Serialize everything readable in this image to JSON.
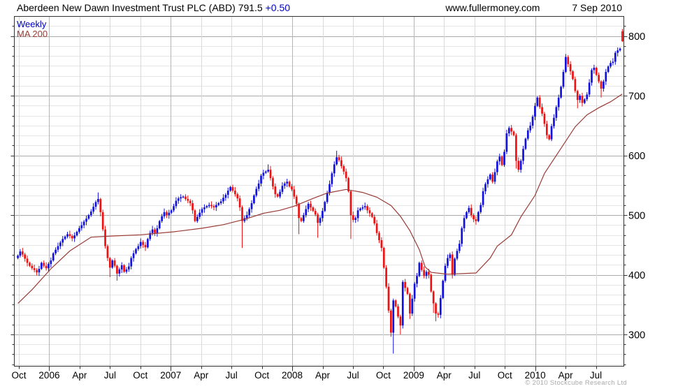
{
  "header": {
    "title": "Aberdeen New Dawn Investment Trust PLC (ABD)",
    "price": "791.5",
    "change": "+0.50",
    "site": "www.fullermoney.com",
    "date": "7 Sep 2010"
  },
  "legend": {
    "timeframe": "Weekly",
    "ma": "MA 200"
  },
  "footer": {
    "copyright": "© 2010 Stockcube Research Ltd"
  },
  "chart_data": {
    "type": "candlestick",
    "timeframe": "weekly",
    "title": "Aberdeen New Dawn Investment Trust PLC (ABD)",
    "last": 791.5,
    "change": 0.5,
    "legend_position": "top-left",
    "grid": true,
    "colors": {
      "up": "#1111dd",
      "down": "#ee1111",
      "ma": "#993b35",
      "grid_minor": "#e6e6e6",
      "grid_major": "#ababab",
      "grid_quarter": "#d9d9d9",
      "grid_year": "#b5b5b5",
      "border": "#333333",
      "tick": "#333333",
      "label": "#000000"
    },
    "y_axis": {
      "ticks": [
        300,
        400,
        500,
        600,
        700,
        800
      ],
      "minor_step": 16.667,
      "approx_range": [
        246,
        834
      ]
    },
    "x_axis": {
      "labels": [
        "Oct",
        "2006",
        "Apr",
        "Jul",
        "Oct",
        "2007",
        "Apr",
        "Jul",
        "Oct",
        "2008",
        "Apr",
        "Jul",
        "Oct",
        "2009",
        "Apr",
        "Jul",
        "Oct",
        "2010",
        "Apr",
        "Jul"
      ],
      "year_indices": [
        1,
        5,
        9,
        13,
        17
      ],
      "weeks_per_quarter": 13
    },
    "first_open": 428,
    "closes": [
      432,
      439,
      434,
      427,
      420,
      415,
      411,
      408,
      404,
      410,
      420,
      415,
      411,
      418,
      424,
      436,
      442,
      448,
      454,
      460,
      464,
      468,
      465,
      461,
      466,
      472,
      478,
      483,
      489,
      494,
      500,
      506,
      514,
      522,
      527,
      505,
      476,
      448,
      428,
      412,
      424,
      415,
      402,
      409,
      416,
      405,
      409,
      414,
      428,
      436,
      443,
      448,
      455,
      450,
      446,
      460,
      470,
      476,
      470,
      478,
      490,
      498,
      505,
      500,
      504,
      508,
      515,
      524,
      528,
      530,
      531,
      527,
      524,
      520,
      508,
      490,
      497,
      504,
      510,
      513,
      515,
      517,
      515,
      513,
      517,
      520,
      523,
      529,
      534,
      541,
      547,
      541,
      535,
      528,
      513,
      490,
      495,
      500,
      510,
      520,
      533,
      544,
      553,
      566,
      571,
      573,
      576,
      562,
      548,
      535,
      531,
      539,
      549,
      553,
      556,
      548,
      543,
      531,
      519,
      495,
      490,
      500,
      510,
      519,
      513,
      507,
      501,
      487,
      495,
      507,
      522,
      537,
      552,
      570,
      585,
      597,
      592,
      582,
      573,
      562,
      540,
      500,
      492,
      495,
      508,
      511,
      513,
      515,
      508,
      503,
      497,
      486,
      470,
      458,
      445,
      412,
      380,
      340,
      303,
      357,
      347,
      330,
      315,
      388,
      378,
      368,
      335,
      360,
      385,
      398,
      420,
      408,
      398,
      405,
      400,
      372,
      352,
      335,
      333,
      361,
      390,
      415,
      428,
      434,
      400,
      427,
      440,
      452,
      478,
      495,
      505,
      512,
      500,
      493,
      490,
      505,
      517,
      540,
      552,
      560,
      568,
      556,
      572,
      590,
      598,
      584,
      606,
      637,
      646,
      640,
      634,
      591,
      576,
      591,
      611,
      628,
      642,
      650,
      665,
      683,
      697,
      681,
      670,
      653,
      634,
      627,
      649,
      663,
      681,
      697,
      715,
      740,
      765,
      753,
      741,
      728,
      708,
      693,
      700,
      688,
      694,
      702,
      722,
      743,
      747,
      735,
      724,
      712,
      724,
      740,
      749,
      755,
      757,
      772,
      776,
      779,
      791.5
    ],
    "ohlc_overrides": {
      "34": [
        522,
        538,
        518,
        527
      ],
      "35": [
        527,
        529,
        498,
        505
      ],
      "39": [
        428,
        430,
        396,
        412
      ],
      "42": [
        415,
        417,
        390,
        402
      ],
      "95": [
        513,
        516,
        445,
        490
      ],
      "106": [
        573,
        585,
        571,
        576
      ],
      "119": [
        519,
        521,
        468,
        495
      ],
      "127": [
        501,
        504,
        462,
        487
      ],
      "135": [
        585,
        608,
        583,
        597
      ],
      "141": [
        540,
        542,
        460,
        500
      ],
      "158": [
        340,
        343,
        296,
        303
      ],
      "159": [
        303,
        360,
        268,
        357
      ],
      "162": [
        330,
        333,
        300,
        315
      ],
      "166": [
        368,
        370,
        326,
        335
      ],
      "176": [
        372,
        374,
        336,
        352
      ],
      "177": [
        352,
        354,
        322,
        335
      ],
      "211": [
        634,
        637,
        578,
        591
      ],
      "232": [
        740,
        770,
        738,
        765
      ],
      "237": [
        708,
        710,
        679,
        693
      ],
      "247": [
        724,
        726,
        697,
        712
      ],
      "256": [
        808,
        812,
        790,
        791.5
      ]
    },
    "ma200_keypoints": [
      [
        0,
        352
      ],
      [
        6,
        375
      ],
      [
        14,
        410
      ],
      [
        22,
        440
      ],
      [
        31,
        463
      ],
      [
        40,
        465
      ],
      [
        52,
        467
      ],
      [
        66,
        472
      ],
      [
        78,
        478
      ],
      [
        87,
        484
      ],
      [
        96,
        493
      ],
      [
        104,
        503
      ],
      [
        111,
        508
      ],
      [
        117,
        515
      ],
      [
        125,
        528
      ],
      [
        131,
        537
      ],
      [
        139,
        543
      ],
      [
        146,
        538
      ],
      [
        152,
        530
      ],
      [
        158,
        516
      ],
      [
        162,
        498
      ],
      [
        166,
        474
      ],
      [
        170,
        442
      ],
      [
        172.5,
        413
      ],
      [
        175,
        404
      ],
      [
        182,
        401
      ],
      [
        194,
        403
      ],
      [
        200,
        428
      ],
      [
        203,
        448
      ],
      [
        209,
        467
      ],
      [
        213,
        497
      ],
      [
        219,
        533
      ],
      [
        223,
        570
      ],
      [
        230,
        612
      ],
      [
        236,
        648
      ],
      [
        241,
        668
      ],
      [
        246,
        680
      ],
      [
        251,
        690
      ],
      [
        256,
        703
      ]
    ]
  }
}
